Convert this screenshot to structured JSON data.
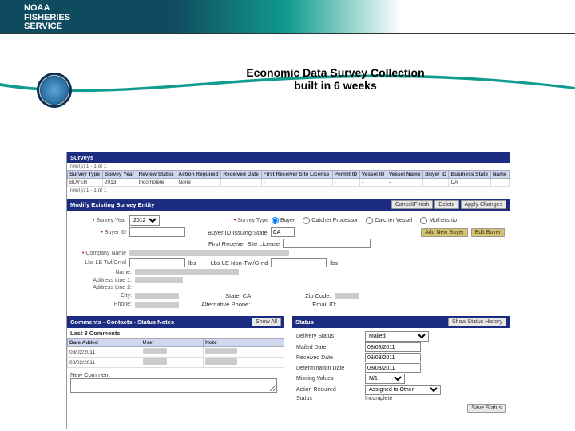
{
  "brand": {
    "line1": "NOAA",
    "line2": "FISHERIES",
    "line3": "SERVICE"
  },
  "title": {
    "line1": "Economic Data Survey Collection",
    "line2": "built in 6 weeks"
  },
  "surveys": {
    "header": "Surveys",
    "rowinfo_top": "row(s) 1 - 1 of 1",
    "rowinfo_bot": "row(s) 1 - 1 of 1",
    "cols": [
      "Survey Type",
      "Survey Year",
      "Review Status",
      "Action Required",
      "Received Date",
      "First Receiver Site License",
      "Permit ID",
      "Vessel ID",
      "Vessel Name",
      "Buyer ID",
      "Business State",
      "Name"
    ],
    "row": {
      "type": "BUYER",
      "year": "2013",
      "review": "Incomplete",
      "action": "None",
      "recv": "-",
      "frsl": "-",
      "permit": "-",
      "vessel": "-",
      "vname": "-",
      "buyer": "",
      "bstate": "CA",
      "name": ""
    }
  },
  "modify": {
    "header": "Modify Existing Survey Entity",
    "buttons": {
      "cancel": "Cancel/Finish",
      "delete": "Delete",
      "apply": "Apply Changes"
    },
    "survey_year_label": "Survey Year",
    "survey_year_value": "2012",
    "survey_type_label": "Survey Type",
    "survey_types": [
      "Buyer",
      "Catcher Processor",
      "Catcher Vessel",
      "Mothership"
    ],
    "buyer_id_label": "Buyer ID",
    "buyer_id_value": "",
    "issuing_state_label": "Buyer ID Issuing State",
    "issuing_state_value": "CA",
    "add_buyer": "Add New Buyer",
    "edit_buyer": "Edit Buyer",
    "frsl_label": "First Receiver Site License",
    "company_label": "Company Name",
    "lbs1_label": "Lbs LE Twl/Grnd",
    "lbs2_label": "Lbs LE Non-Twl/Grnd",
    "lbs_unit": "lbs",
    "name_label": "Name:",
    "addr1_label": "Address Line 1:",
    "addr2_label": "Address Line 2:",
    "city_label": "City:",
    "state_label": "State: CA",
    "zip_label": "Zip Code:",
    "phone_label": "Phone:",
    "altphone_label": "Alternative Phone:",
    "email_label": "Email ID:"
  },
  "comments": {
    "header": "Comments - Contacts - Status Notes",
    "showall": "Show All",
    "subhead": "Last 3 Comments",
    "cols": [
      "Date Added",
      "User",
      "Note"
    ],
    "rows": [
      {
        "date": "08/02/2011",
        "user": "",
        "note": ""
      },
      {
        "date": "08/02/2011",
        "user": "",
        "note": ""
      }
    ],
    "newc": "New Comment"
  },
  "status": {
    "header": "Status",
    "history": "Show Status History",
    "fields": {
      "delivery_status": "Delivery Status",
      "delivery_status_v": "Mailed",
      "mailed": "Mailed Date",
      "mailed_v": "08/08/2011",
      "received": "Received Date",
      "received_v": "08/03/2011",
      "determ": "Determination Date",
      "determ_v": "08/03/2011",
      "missing": "Missing Values",
      "missing_v": "N/1",
      "action": "Action Required",
      "action_v": "Assigned to Other",
      "stat": "Status",
      "stat_v": "Incomplete"
    },
    "save": "Save Status"
  }
}
